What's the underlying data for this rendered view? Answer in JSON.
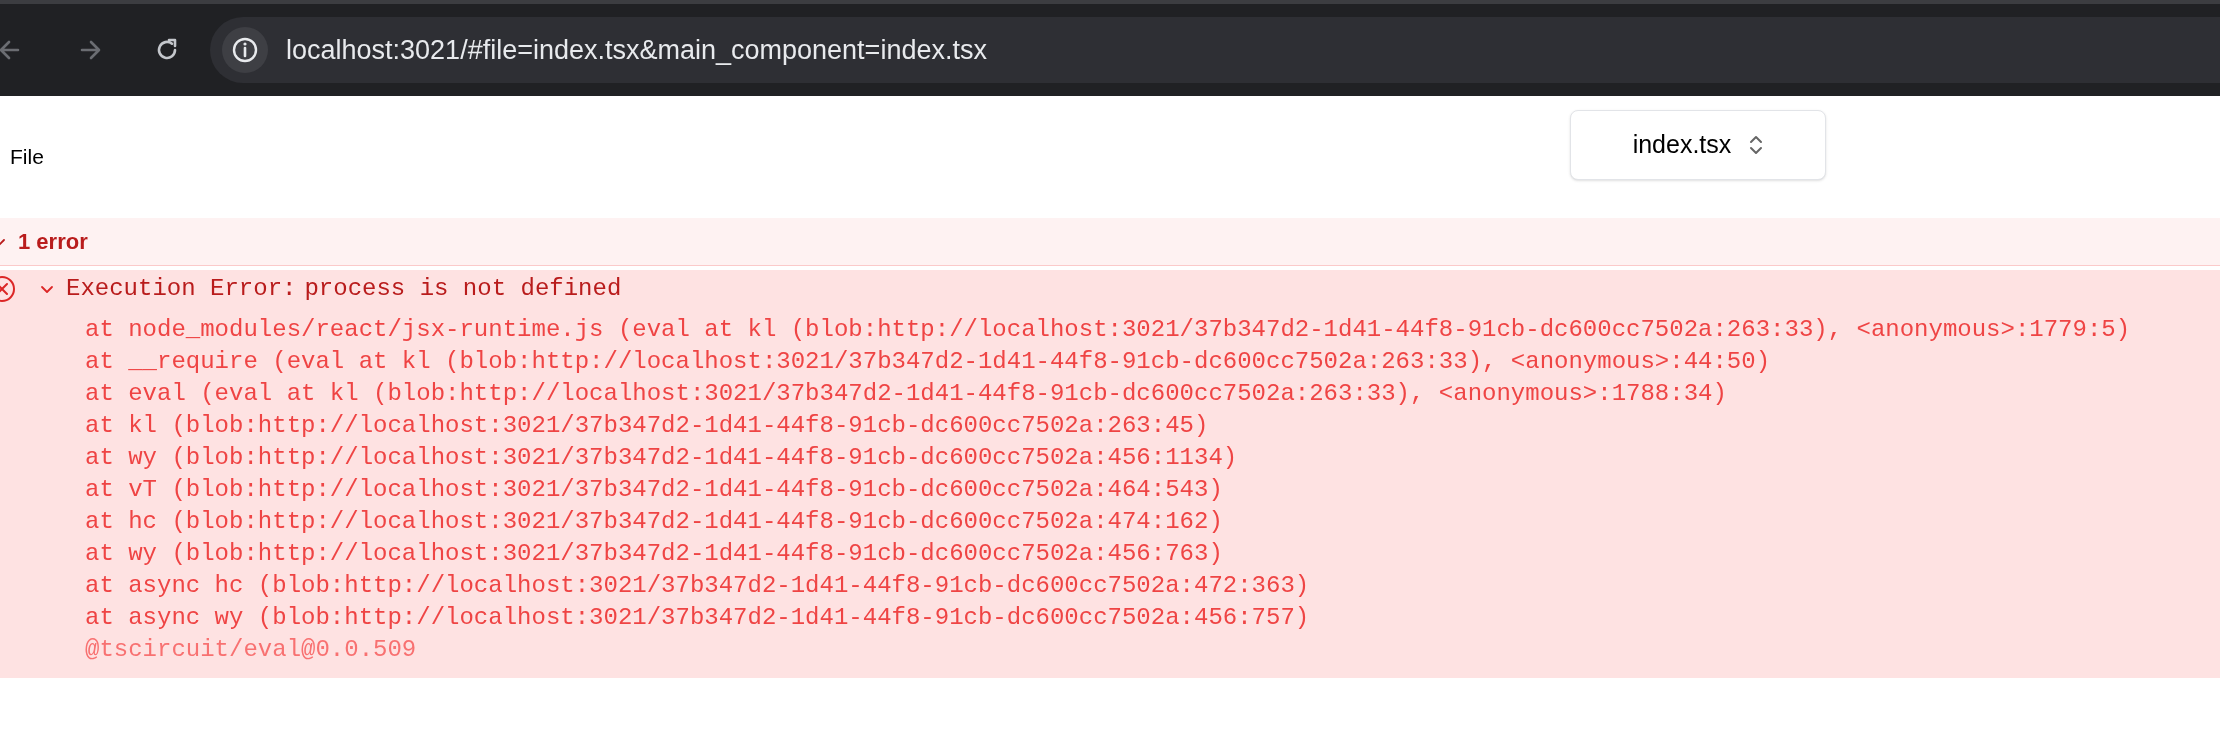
{
  "browser": {
    "url": "localhost:3021/#file=index.tsx&main_component=index.tsx"
  },
  "file_row": {
    "label": "File",
    "select": {
      "value": "index.tsx"
    }
  },
  "errors": {
    "summary": "1 error",
    "expanded": true,
    "items": [
      {
        "label": "Execution Error:",
        "message": "process is not defined",
        "expanded": true,
        "stack": [
          "at node_modules/react/jsx-runtime.js (eval at kl (blob:http://localhost:3021/37b347d2-1d41-44f8-91cb-dc600cc7502a:263:33), <anonymous>:1779:5)",
          "at __require (eval at kl (blob:http://localhost:3021/37b347d2-1d41-44f8-91cb-dc600cc7502a:263:33), <anonymous>:44:50)",
          "at eval (eval at kl (blob:http://localhost:3021/37b347d2-1d41-44f8-91cb-dc600cc7502a:263:33), <anonymous>:1788:34)",
          "at kl (blob:http://localhost:3021/37b347d2-1d41-44f8-91cb-dc600cc7502a:263:45)",
          "at wy (blob:http://localhost:3021/37b347d2-1d41-44f8-91cb-dc600cc7502a:456:1134)",
          "at vT (blob:http://localhost:3021/37b347d2-1d41-44f8-91cb-dc600cc7502a:464:543)",
          "at hc (blob:http://localhost:3021/37b347d2-1d41-44f8-91cb-dc600cc7502a:474:162)",
          "at wy (blob:http://localhost:3021/37b347d2-1d41-44f8-91cb-dc600cc7502a:456:763)",
          "at async hc (blob:http://localhost:3021/37b347d2-1d41-44f8-91cb-dc600cc7502a:472:363)",
          "at async wy (blob:http://localhost:3021/37b347d2-1d41-44f8-91cb-dc600cc7502a:456:757)"
        ],
        "version": "@tscircuit/eval@0.0.509"
      }
    ]
  }
}
